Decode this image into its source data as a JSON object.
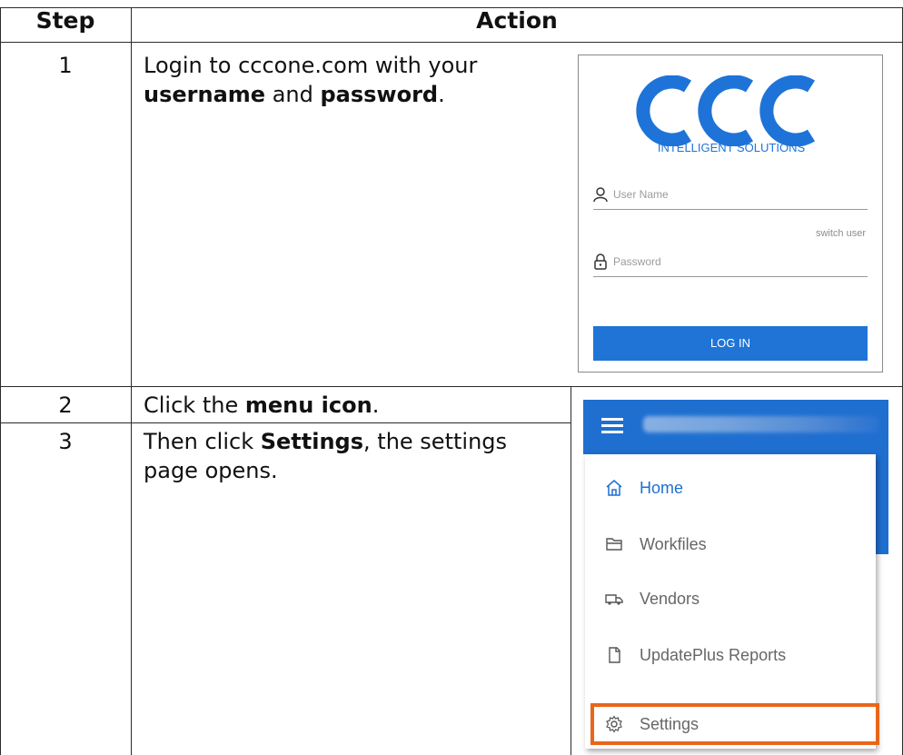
{
  "table": {
    "headers": {
      "step": "Step",
      "action": "Action"
    },
    "rows": [
      {
        "step": "1",
        "text_parts": [
          "Login to cccone.com with your ",
          "username",
          " and ",
          "password",
          "."
        ]
      },
      {
        "step": "2",
        "text_parts": [
          "Click the ",
          "menu icon",
          "."
        ]
      },
      {
        "step": "3",
        "text_parts": [
          "Then click ",
          "Settings",
          ", the settings page opens."
        ]
      }
    ]
  },
  "login_screen": {
    "logo_text": "CCC",
    "logo_tagline": "INTELLIGENT SOLUTIONS",
    "username_placeholder": "User Name",
    "switch_user_label": "switch user",
    "password_placeholder": "Password",
    "login_button_label": "LOG IN",
    "brand_color": "#1F74D6"
  },
  "menu_screen": {
    "header_color": "#1F6FD0",
    "items": [
      {
        "label": "Home",
        "icon": "home-icon"
      },
      {
        "label": "Workfiles",
        "icon": "folder-icon"
      },
      {
        "label": "Vendors",
        "icon": "truck-icon"
      },
      {
        "label": "UpdatePlus Reports",
        "icon": "report-icon"
      },
      {
        "label": "Settings",
        "icon": "gear-icon"
      }
    ],
    "highlight_color": "#E8661A"
  }
}
